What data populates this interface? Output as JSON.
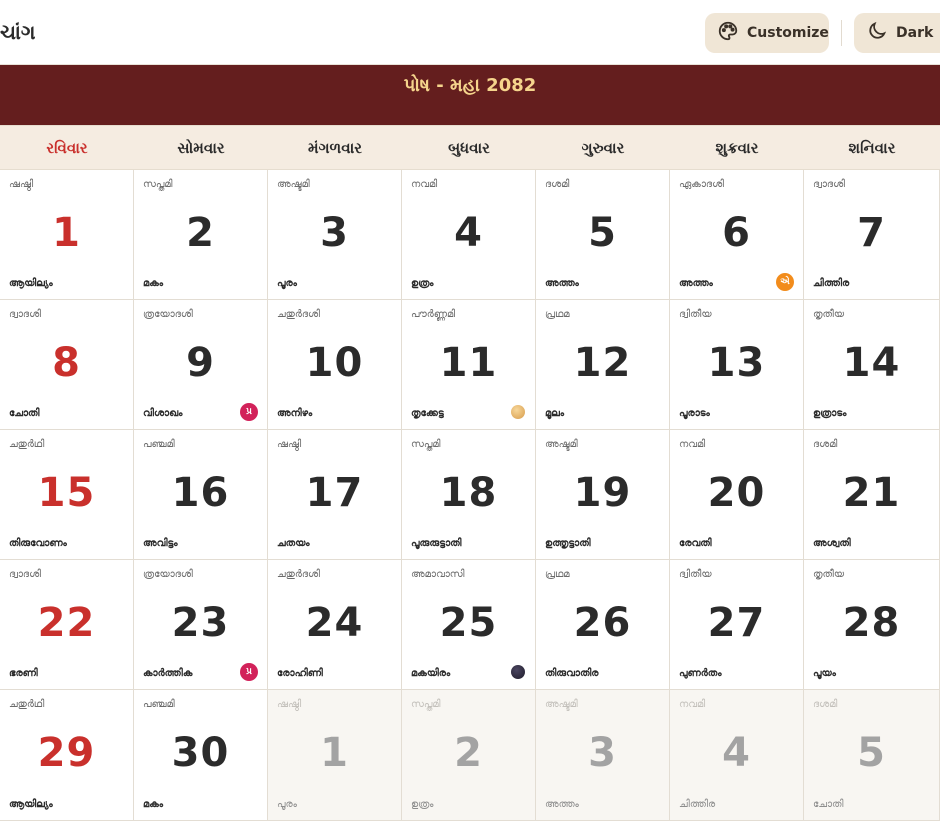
{
  "app": {
    "brand": "ચાંગ"
  },
  "toolbar": {
    "customize_label": "Customize",
    "dark_label": "Dark"
  },
  "banner": {
    "month_label": "પોષ - મહા 2082"
  },
  "weekdays": [
    "રવિવાર",
    "સોમવાર",
    "મંગળવાર",
    "બુધવાર",
    "ગુરુવાર",
    "શુક્રવાર",
    "શનિવાર"
  ],
  "weeks": [
    [
      {
        "tithi": "ഷഷ്ഠി",
        "day": "1",
        "nak": "ആയില്യം"
      },
      {
        "tithi": "സപ്തമി",
        "day": "2",
        "nak": "മകം"
      },
      {
        "tithi": "അഷ്ടമി",
        "day": "3",
        "nak": "പൂരം"
      },
      {
        "tithi": "നവമി",
        "day": "4",
        "nak": "ഉത്രം"
      },
      {
        "tithi": "ദശമി",
        "day": "5",
        "nak": "അത്തം"
      },
      {
        "tithi": "ഏകാദശി",
        "day": "6",
        "nak": "അത്തം",
        "badge": "એ"
      },
      {
        "tithi": "ദ്വാദശി",
        "day": "7",
        "nak": "ചിത്തിര"
      }
    ],
    [
      {
        "tithi": "ദ്വാദശി",
        "day": "8",
        "nak": "ചോതി"
      },
      {
        "tithi": "ത്രയോദശി",
        "day": "9",
        "nak": "വിശാഖം",
        "badge": "પ્ર"
      },
      {
        "tithi": "ചതുർദശി",
        "day": "10",
        "nak": "അനിഴം"
      },
      {
        "tithi": "പൗർണ്ണമി",
        "day": "11",
        "nak": "തൃക്കേട്ട",
        "moon": "full"
      },
      {
        "tithi": "പ്രഥമ",
        "day": "12",
        "nak": "മൂലം"
      },
      {
        "tithi": "ദ്വിതീയ",
        "day": "13",
        "nak": "പൂരാടം"
      },
      {
        "tithi": "തൃതീയ",
        "day": "14",
        "nak": "ഉത്രാടം"
      }
    ],
    [
      {
        "tithi": "ചതുർഥി",
        "day": "15",
        "nak": "തിരുവോണം"
      },
      {
        "tithi": "പഞ്ചമി",
        "day": "16",
        "nak": "അവിട്ടം"
      },
      {
        "tithi": "ഷഷ്ഠി",
        "day": "17",
        "nak": "ചതയം"
      },
      {
        "tithi": "സപ്തമി",
        "day": "18",
        "nak": "പൂരുരുട്ടാതി"
      },
      {
        "tithi": "അഷ്ടമി",
        "day": "19",
        "nak": "ഉത്തൃട്ടാതി"
      },
      {
        "tithi": "നവമി",
        "day": "20",
        "nak": "രേവതി"
      },
      {
        "tithi": "ദശമി",
        "day": "21",
        "nak": "അശ്വതി"
      }
    ],
    [
      {
        "tithi": "ദ്വാദശി",
        "day": "22",
        "nak": "ഭരണി"
      },
      {
        "tithi": "ത്രയോദശി",
        "day": "23",
        "nak": "കാർത്തിക",
        "badge": "પ્ર"
      },
      {
        "tithi": "ചതുർദശി",
        "day": "24",
        "nak": "രോഹിണി"
      },
      {
        "tithi": "അമാവാസി",
        "day": "25",
        "nak": "മകയിരം",
        "moon": "new"
      },
      {
        "tithi": "പ്രഥമ",
        "day": "26",
        "nak": "തിരുവാതിര"
      },
      {
        "tithi": "ദ്വിതീയ",
        "day": "27",
        "nak": "പുണർതം"
      },
      {
        "tithi": "തൃതീയ",
        "day": "28",
        "nak": "പൂയം"
      }
    ],
    [
      {
        "tithi": "ചതുർഥി",
        "day": "29",
        "nak": "ആയില്യം"
      },
      {
        "tithi": "പഞ്ചമി",
        "day": "30",
        "nak": "മകം"
      },
      {
        "tithi": "ഷഷ്ഠി",
        "day": "1",
        "nak": "പൂരം",
        "other": true
      },
      {
        "tithi": "സപ്തമി",
        "day": "2",
        "nak": "ഉത്രം",
        "other": true
      },
      {
        "tithi": "അഷ്ടമി",
        "day": "3",
        "nak": "അത്തം",
        "other": true
      },
      {
        "tithi": "നവമി",
        "day": "4",
        "nak": "ചിത്തിര",
        "other": true
      },
      {
        "tithi": "ദശമി",
        "day": "5",
        "nak": "ചോതി",
        "other": true
      }
    ]
  ],
  "colors": {
    "banner": "#641e1e",
    "accent_gold": "#f5d48c",
    "sunday_red": "#c9302c"
  }
}
